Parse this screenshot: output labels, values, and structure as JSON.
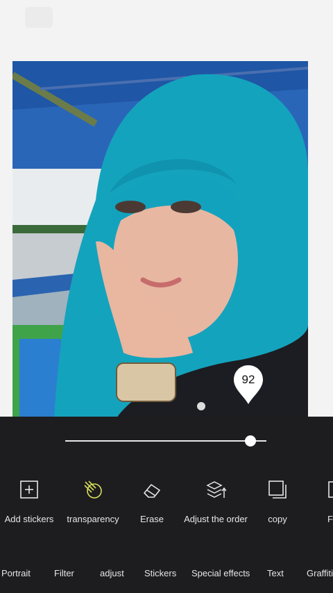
{
  "editor": {
    "opacity_value": "92",
    "opacity_level_percent": 92
  },
  "tools": [
    {
      "label": "Add stickers",
      "icon": "add-sticker-icon"
    },
    {
      "label": "transparency",
      "icon": "transparency-icon",
      "accent": "#d8e05a"
    },
    {
      "label": "Erase",
      "icon": "eraser-icon"
    },
    {
      "label": "Adjust the order",
      "icon": "layers-order-icon"
    },
    {
      "label": "copy",
      "icon": "copy-icon"
    },
    {
      "label": "F",
      "icon": "partial-tool-icon"
    }
  ],
  "tabs": [
    "Portrait",
    "Filter",
    "adjust",
    "Stickers",
    "Special effects",
    "Text",
    "Graffiti"
  ],
  "colors": {
    "panel_bg": "#1d1d1f",
    "accent": "#d8e05a",
    "text": "#e6e6e6"
  }
}
